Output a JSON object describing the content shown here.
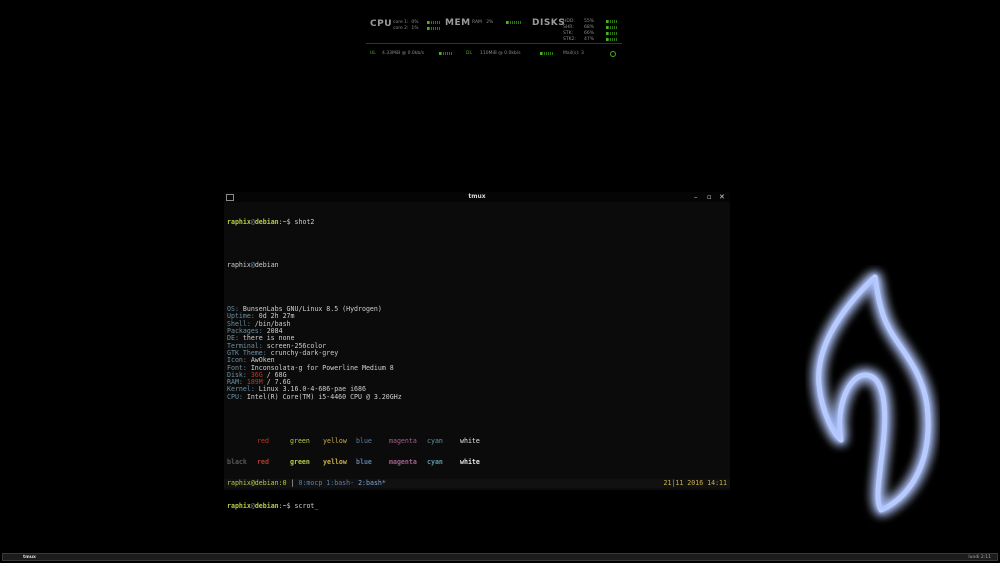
{
  "conky": {
    "cpu_label": "CPU",
    "cpu_lines": "core 1:  0%\ncore 2:  1%",
    "mem_label": "MEM",
    "mem_line": "RAM   2%",
    "disks_label": "DISKS",
    "disk_names": "HDD:\nSHR:\nSTK:\nSTK2:",
    "disk_values": "55%\n68%\n66%\n47%",
    "up_label": "UL",
    "up_value": "4.33MiB @ 0.0kb/s",
    "down_label": "DL",
    "down_value": "110MiB @ 0.0kb/s",
    "mail": "Mail(s): 3",
    "accent": "#4caf1f"
  },
  "window": {
    "title": "tmux",
    "minimize": "–",
    "maximize": "▫",
    "close": "✕"
  },
  "terminal": {
    "prompt_user": "raphix",
    "prompt_at": "@",
    "prompt_host": "debian",
    "prompt_tail": ":~$ ",
    "cmd1": "shot2",
    "title_user": "raphix",
    "title_at": "@",
    "title_host": "debian",
    "info": [
      {
        "key": "OS:",
        "value": " BunsenLabs GNU/Linux 8.5 (Hydrogen)"
      },
      {
        "key": "Uptime:",
        "value": " 0d 2h 27m"
      },
      {
        "key": "Shell:",
        "value": " /bin/bash"
      },
      {
        "key": "Packages:",
        "value": " 2084"
      },
      {
        "key": "DE:",
        "value": " there is none"
      },
      {
        "key": "Terminal:",
        "value": " screen-256color"
      },
      {
        "key": "GTK Theme:",
        "value": " crunchy-dark-grey"
      },
      {
        "key": "Icon:",
        "value": " AwOken"
      },
      {
        "key": "Font:",
        "value": " Inconsolata-g for Powerline Medium 8"
      },
      {
        "key": "Disk:",
        "value_em": " 36G",
        "value": " / 68G"
      },
      {
        "key": "RAM:",
        "value_em": " 189M",
        "value": " / 7.6G"
      },
      {
        "key": "Kernel:",
        "value": " Linux 3.16.0-4-686-pae i686"
      },
      {
        "key": "CPU:",
        "value": " Intel(R) Core(TM) i5-4460 CPU @ 3.20GHz"
      }
    ],
    "palette_row1": [
      "",
      "red",
      "green",
      "yellow",
      "blue",
      "magenta",
      "cyan",
      "white"
    ],
    "palette_row2": [
      "black",
      "red",
      "green",
      "yellow",
      "blue",
      "magenta",
      "cyan",
      "white"
    ],
    "cmd2": "scrot",
    "cursor": "_"
  },
  "tmux_status": {
    "session": "raphix@debian:0",
    "sep": " | ",
    "w0": "0:mocp",
    "w1": "1:bash-",
    "w2": "2:bash*",
    "time": "21|11 2016 14:11"
  },
  "panel": {
    "task": "tmux",
    "clock": "lundi 2:11"
  }
}
